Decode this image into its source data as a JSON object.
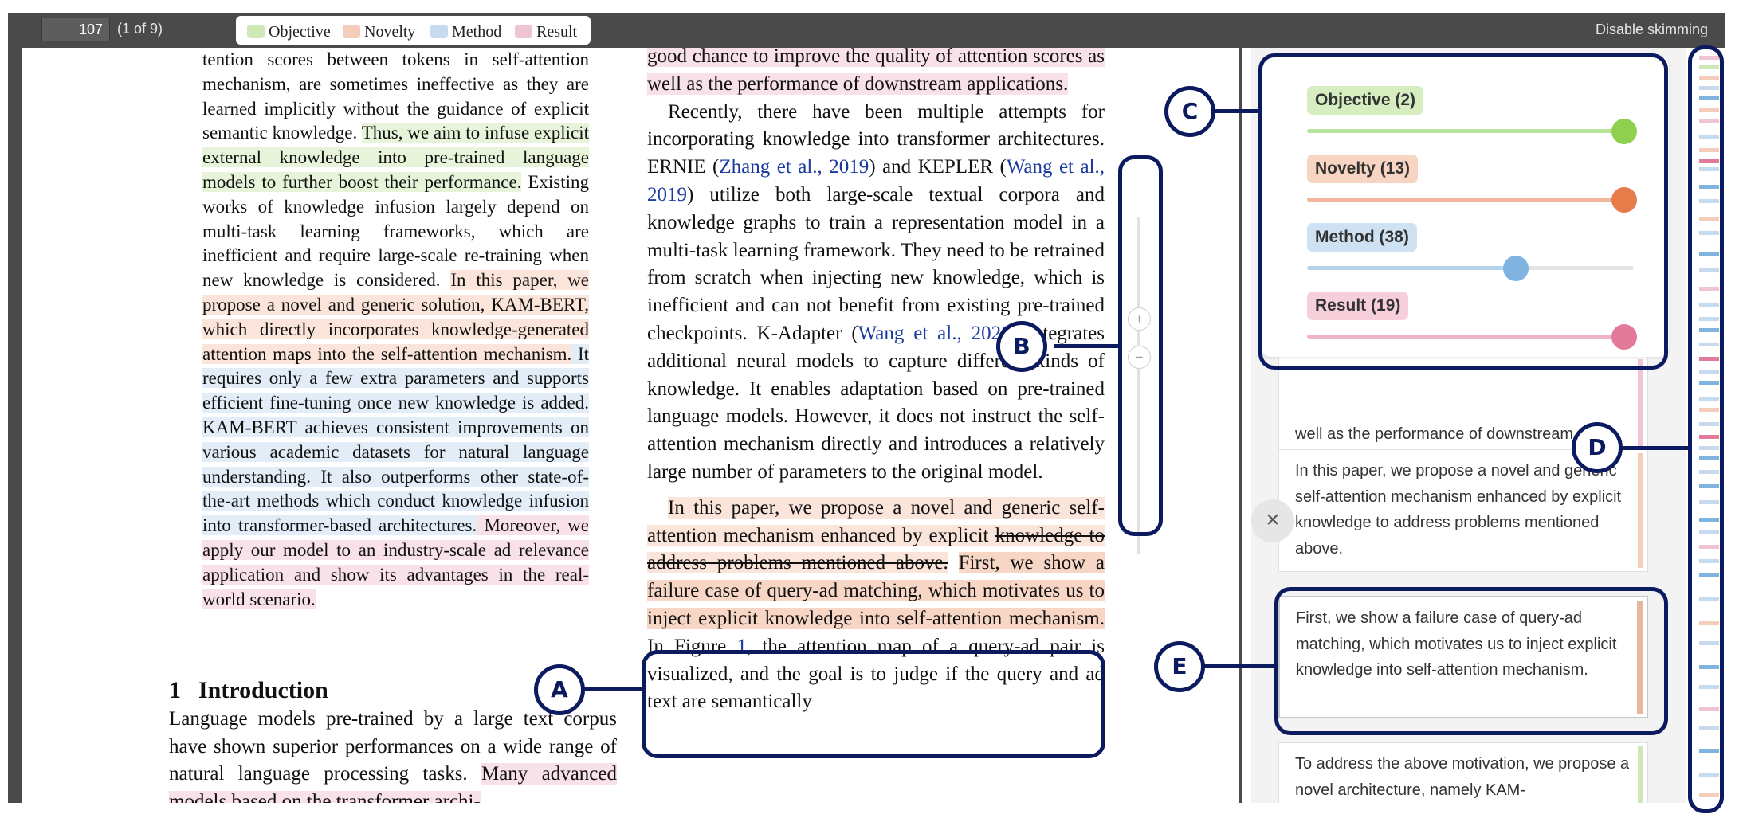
{
  "toolbar": {
    "page_number": "107",
    "page_count": "(1 of 9)",
    "skim_toggle": "Disable skimming",
    "legend": [
      {
        "label": "Objective",
        "color": "#cfe9b6"
      },
      {
        "label": "Novelty",
        "color": "#f5cdbb"
      },
      {
        "label": "Method",
        "color": "#c6dbf0"
      },
      {
        "label": "Result",
        "color": "#efc5d3"
      }
    ]
  },
  "paper": {
    "left_column": {
      "text_a": "tention scores between tokens in self-attention mechanism, are sometimes ineffective as they are learned implicitly without the guidance of explicit semantic knowledge. ",
      "objective": "Thus, we aim to infuse explicit external knowledge into pre-trained language models to further boost their performance.",
      "text_b": " Existing works of knowledge infusion largely depend on multi-task learning frameworks, which are inefficient and require large-scale re-training when new knowledge is considered. ",
      "novelty": "In this paper, we propose a novel and generic solution, KAM-BERT, which directly incorporates knowledge-generated attention maps into the self-attention mechanism.",
      "method": " It requires only a few extra parameters and supports efficient fine-tuning once new knowledge is added. KAM-BERT achieves consistent improvements on various academic datasets for natural language understanding. It also outperforms other state-of-the-art methods which conduct knowledge infusion into transformer-based architectures.",
      "result": " Moreover, we apply our model to an industry-scale ad relevance application and show its advantages in the real-world scenario."
    },
    "section": {
      "number": "1",
      "title": "Introduction"
    },
    "intro": {
      "text": "Language models pre-trained by a large text corpus have shown superior performances on a wide range of natural language processing tasks. ",
      "result_tail": "Many advanced models based on the transformer archi-"
    },
    "right_column": {
      "p1_result": "good chance to improve the quality of attention scores as well as the performance of downstream applications.",
      "p2_a": "Recently, there have been multiple attempts for incorporating knowledge into transformer architectures. ERNIE (",
      "cite1": "Zhang et al., 2019",
      "p2_b": ") and KEPLER (",
      "cite2": "Wang et al., 2019",
      "p2_c": ") utilize both large-scale textual corpora and knowledge graphs to train a representation model in a multi-task learning framework. They need to be retrained from scratch when injecting new knowledge, which is inefficient and can not benefit from existing pre-trained checkpoints. K-Adapter (",
      "cite3": "Wang et al., 2020",
      "p2_d": ") integrates additional neural models to capture different kinds of knowledge. It enables adaptation based on pre-trained language models. However, it does not instruct the self-attention mechanism directly and introduces a relatively large number of parameters to the original model.",
      "p3_novelty": "In this paper, we propose a novel and generic self-attention mechanism enhanced by explicit ",
      "p3_strike": "knowledge to address problems mentioned above.",
      "p3_selected": "First, we show a failure case of query-ad matching, which motivates us to inject explicit knowledge into self-attention mechanism.",
      "p3_a": " In Figure ",
      "cite4": "1",
      "p3_b": ", the attention map of a query-ad pair is visualized, and the goal is to judge if the query and ad text are semantically"
    }
  },
  "zoom": {
    "zoom_in_icon": "+",
    "zoom_out_icon": "−"
  },
  "facets": [
    {
      "label": "Objective (2)",
      "label_bg": "#d6edc0",
      "track": "#b7e39a",
      "knob": "#8fd14f",
      "level": 0.97
    },
    {
      "label": "Novelty (13)",
      "label_bg": "#f8d4c2",
      "track": "#f1b79c",
      "knob": "#e57c4a",
      "level": 0.97
    },
    {
      "label": "Method (38)",
      "label_bg": "#cfe2f3",
      "track": "#b6d3ec",
      "knob": "#7fb4e0",
      "level": 0.64
    },
    {
      "label": "Result (19)",
      "label_bg": "#f6cfda",
      "track": "#eeb5c6",
      "knob": "#e27b9a",
      "level": 0.97
    }
  ],
  "cards": [
    {
      "text": "well as the performance of downstream applications.",
      "color": "#efc5d3"
    },
    {
      "text": "In this paper, we propose a novel and generic self-attention mechanism enhanced by explicit knowledge to address problems mentioned above.",
      "color": "#f5cdbb"
    },
    {
      "text": "First, we show a failure case of query-ad matching, which motivates us to inject explicit knowledge into self-attention mechanism.",
      "color": "#e9b79d"
    },
    {
      "text": "To address the above motivation, we propose a novel architecture, namely KAM-",
      "color": "#cfe9b6"
    }
  ],
  "close_icon": "×",
  "callouts": {
    "a": "A",
    "b": "B",
    "c": "C",
    "d": "D",
    "e": "E"
  },
  "minimap": {
    "colors": [
      "#efc5d3",
      "#cfe9b6",
      "#f5cdbb",
      "#c6dbf0",
      "#7fb4e0",
      "#e27b9a"
    ]
  }
}
